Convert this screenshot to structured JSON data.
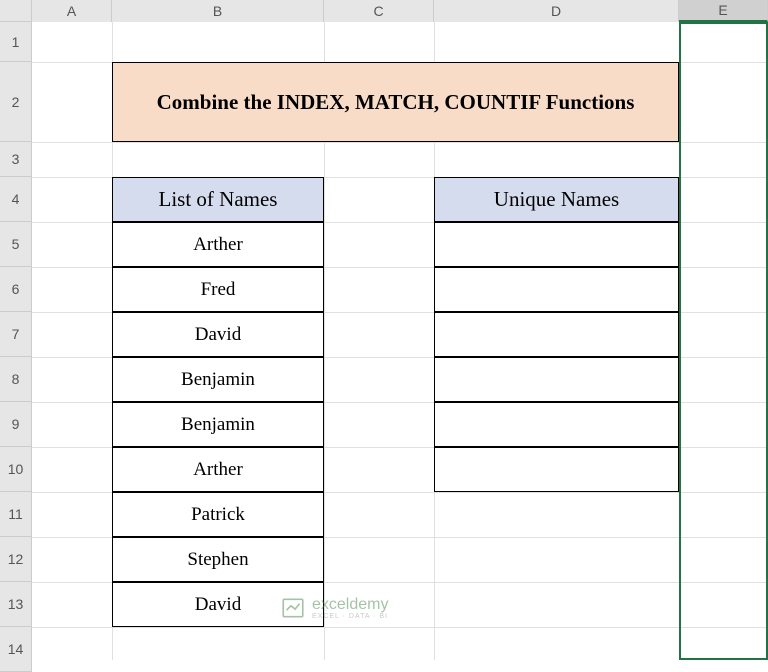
{
  "columns": [
    "A",
    "B",
    "C",
    "D",
    "E"
  ],
  "rows": [
    "1",
    "2",
    "3",
    "4",
    "5",
    "6",
    "7",
    "8",
    "9",
    "10",
    "11",
    "12",
    "13",
    "14"
  ],
  "selected_column": "E",
  "title": "Combine the INDEX, MATCH, COUNTIF Functions",
  "headers": {
    "list_names": "List of Names",
    "unique_names": "Unique Names"
  },
  "list_data": [
    "Arther",
    "Fred",
    "David",
    "Benjamin",
    "Benjamin",
    "Arther",
    "Patrick",
    "Stephen",
    "David"
  ],
  "unique_data": [
    "",
    "",
    "",
    "",
    "",
    ""
  ],
  "watermark": {
    "main": "exceldemy",
    "sub": "EXCEL · DATA · BI"
  }
}
